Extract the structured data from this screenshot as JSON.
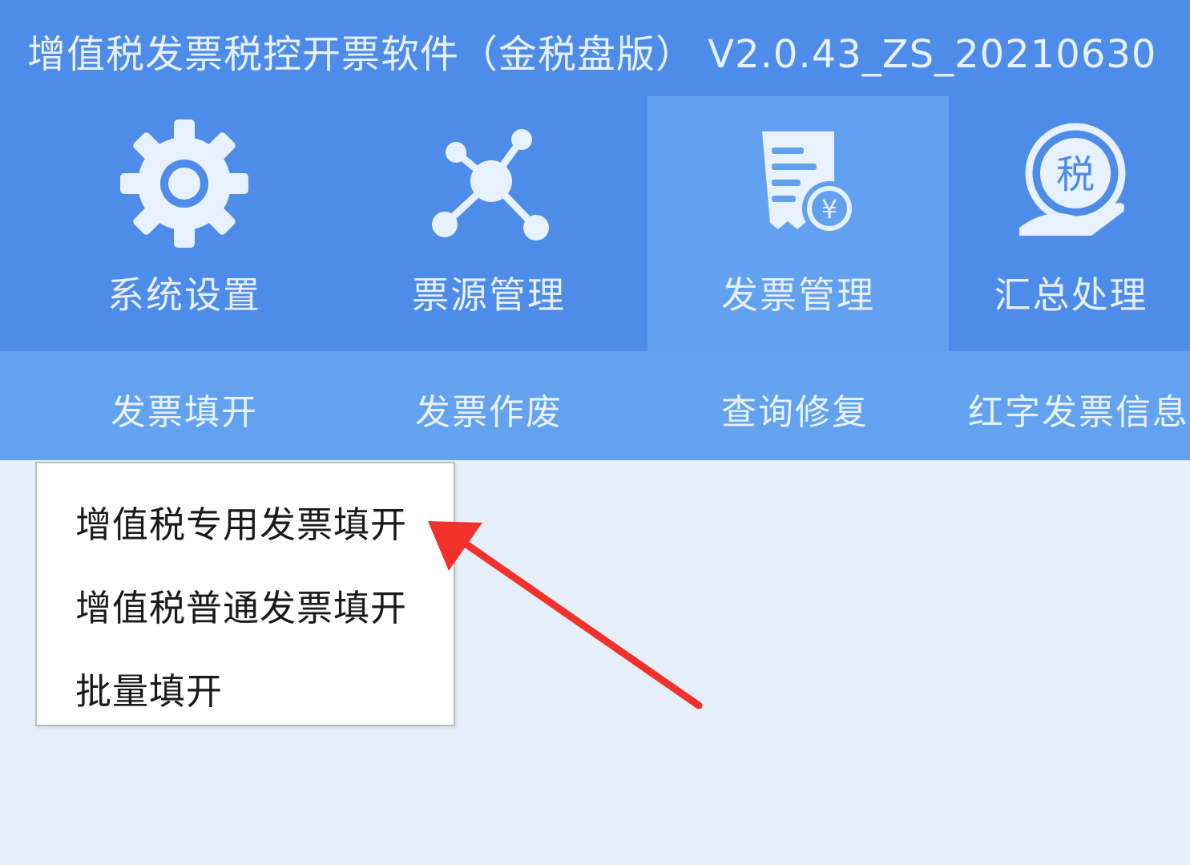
{
  "window": {
    "title": "增值税发票税控开票软件（金税盘版） V2.0.43_ZS_20210630"
  },
  "modules": [
    {
      "label": "系统设置",
      "icon": "gear-icon",
      "active": false
    },
    {
      "label": "票源管理",
      "icon": "network-nodes-icon",
      "active": false
    },
    {
      "label": "发票管理",
      "icon": "invoice-yuan-icon",
      "active": true
    },
    {
      "label": "汇总处理",
      "icon": "tax-hand-icon",
      "active": false
    }
  ],
  "subtabs": [
    "发票填开",
    "发票作废",
    "查询修复",
    "红字发票信息"
  ],
  "dropdown": {
    "items": [
      "增值税专用发票填开",
      "增值税普通发票填开",
      "批量填开"
    ]
  },
  "colors": {
    "title_bar": "#4e8ce9",
    "ribbon": "#4e8ce9",
    "ribbon_active": "#62a1ef",
    "subtab_bar": "#63a2ee",
    "content_bg": "#e6eef8",
    "annotation_arrow": "#f0312c"
  },
  "annotation": {
    "icon": "red-arrow-icon",
    "points_to": "增值税专用发票填开"
  }
}
